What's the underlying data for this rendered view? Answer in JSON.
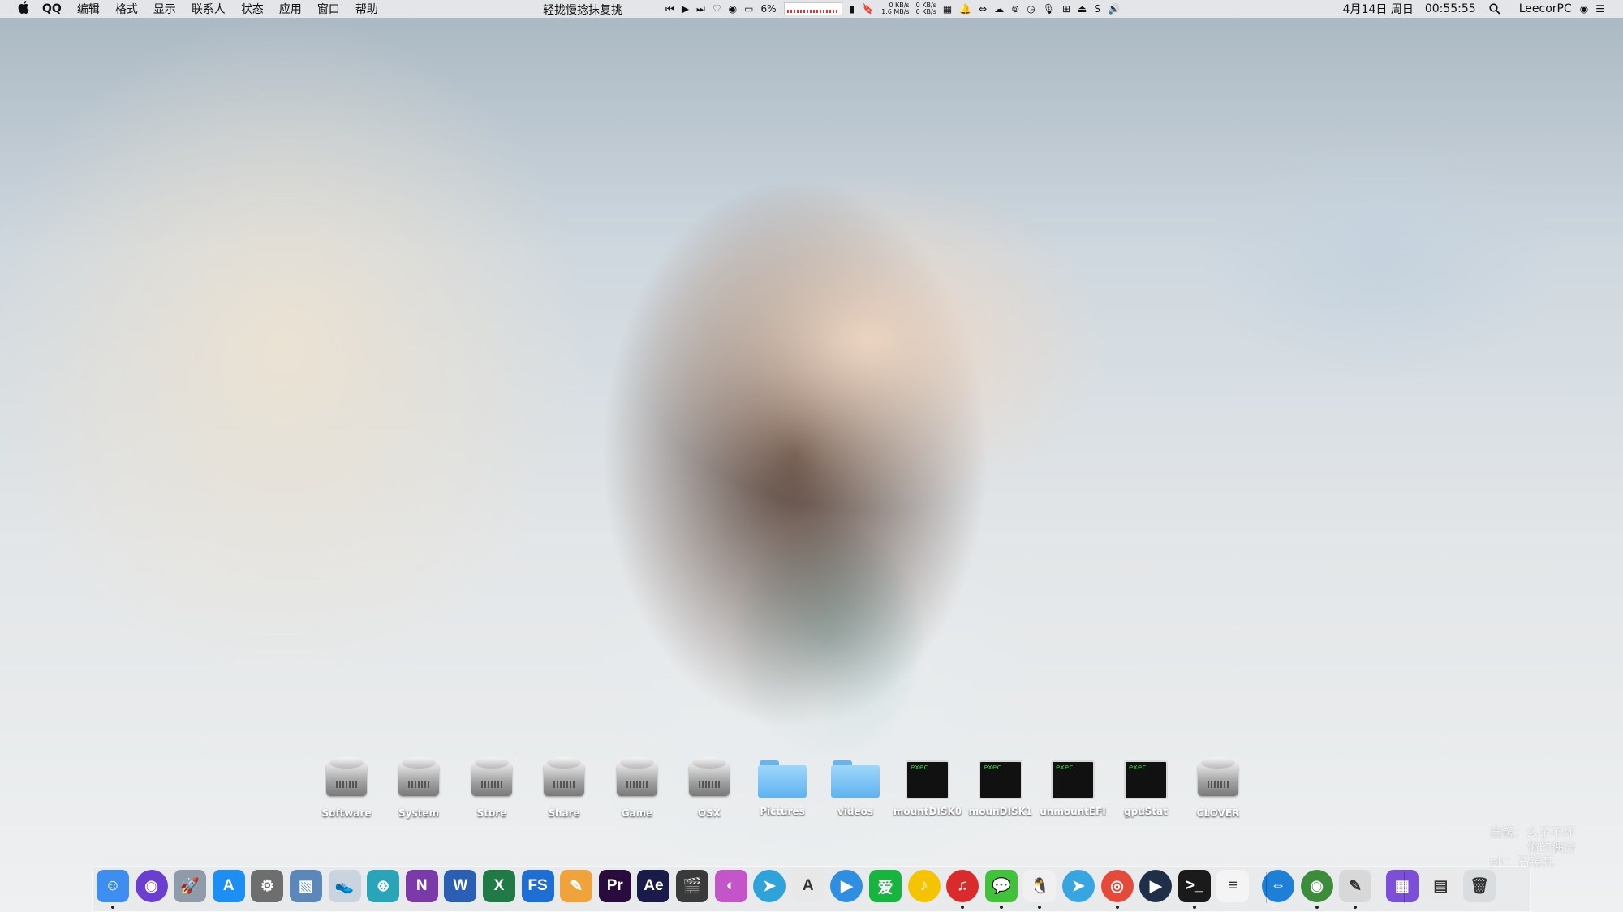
{
  "menubar": {
    "apple_icon": "apple-icon",
    "app_name": "QQ",
    "menus": [
      "编辑",
      "格式",
      "显示",
      "联系人",
      "状态",
      "应用",
      "窗口",
      "帮助"
    ],
    "now_playing": "轻拢慢捻抹复挑",
    "status": {
      "cpu_percent": "6%",
      "net_up": "0 KB/s",
      "net_down": "1.6 MB/s",
      "net2_up": "0 KB/s",
      "net2_down": "0 KB/s"
    },
    "date": "4月14日 周日",
    "time": "00:55:55",
    "user": "LeecorPC"
  },
  "desktop": {
    "icons": [
      {
        "label": "Software",
        "kind": "disk"
      },
      {
        "label": "System",
        "kind": "disk"
      },
      {
        "label": "Store",
        "kind": "disk"
      },
      {
        "label": "Share",
        "kind": "disk"
      },
      {
        "label": "Game",
        "kind": "disk"
      },
      {
        "label": "OSX",
        "kind": "disk"
      },
      {
        "label": "Pictures",
        "kind": "folder"
      },
      {
        "label": "videos",
        "kind": "folder"
      },
      {
        "label": "mountDISK0",
        "kind": "exec"
      },
      {
        "label": "mounDISK1",
        "kind": "exec"
      },
      {
        "label": "unmountEFI",
        "kind": "exec"
      },
      {
        "label": "gpuStat",
        "kind": "exec"
      },
      {
        "label": "CLOVER",
        "kind": "disk"
      }
    ],
    "exec_badge": "exec",
    "watermark_line1": "出镜：么子不坏",
    "watermark_line2": "你的偶分",
    "watermark_line3": "ph：石镜其"
  },
  "dock": {
    "apps": [
      {
        "name": "finder-icon",
        "text": "☺",
        "color": "#3e8ef0",
        "running": true
      },
      {
        "name": "siri-icon",
        "text": "◉",
        "color": "#6a3fd0",
        "running": false
      },
      {
        "name": "launchpad-icon",
        "text": "🚀",
        "color": "#8f9ba8",
        "running": false
      },
      {
        "name": "app-store-icon",
        "text": "A",
        "color": "#1c8ef4",
        "running": false
      },
      {
        "name": "system-preferences-icon",
        "text": "⚙",
        "color": "#6e6e6e",
        "running": false
      },
      {
        "name": "preview-icon",
        "text": "▧",
        "color": "#5b88b8",
        "running": false
      },
      {
        "name": "sneaker-icon",
        "text": "👟",
        "color": "#c9d4de",
        "running": false
      },
      {
        "name": "network-tool-icon",
        "text": "⊛",
        "color": "#2aa4b8",
        "running": false
      },
      {
        "name": "onenote-icon",
        "text": "N",
        "color": "#7a3aa8",
        "running": false
      },
      {
        "name": "word-icon",
        "text": "W",
        "color": "#2b5fb4",
        "running": false
      },
      {
        "name": "excel-icon",
        "text": "X",
        "color": "#1f7a45",
        "running": false
      },
      {
        "name": "fs-icon",
        "text": "FS",
        "color": "#1d6fd4",
        "running": false
      },
      {
        "name": "pages-icon",
        "text": "✎",
        "color": "#f0a33a",
        "running": false
      },
      {
        "name": "premiere-icon",
        "text": "Pr",
        "color": "#2a0b3d",
        "running": false
      },
      {
        "name": "after-effects-icon",
        "text": "Ae",
        "color": "#1b1b4a",
        "running": false
      },
      {
        "name": "final-cut-icon",
        "text": "🎬",
        "color": "#3a3a3a",
        "running": false
      },
      {
        "name": "pixelmator-icon",
        "text": "◐",
        "color": "#c455c8",
        "running": false
      },
      {
        "name": "telegram-icon",
        "text": "➤",
        "color": "#2fa3d9",
        "running": false
      },
      {
        "name": "acrobat-icon",
        "text": "A",
        "color": "#e8e8e8",
        "running": false
      },
      {
        "name": "video-player-icon",
        "text": "▶",
        "color": "#2f8ee0",
        "running": false
      },
      {
        "name": "iqiyi-icon",
        "text": "爱",
        "color": "#16b63e",
        "running": false
      },
      {
        "name": "music-icon",
        "text": "♪",
        "color": "#f5c400",
        "running": false
      },
      {
        "name": "netease-music-icon",
        "text": "♫",
        "color": "#d92b2b",
        "running": true
      },
      {
        "name": "wechat-icon",
        "text": "💬",
        "color": "#42c13a",
        "running": true
      },
      {
        "name": "qq-icon",
        "text": "🐧",
        "color": "#f0f0f0",
        "running": true
      },
      {
        "name": "telegram-desktop-icon",
        "text": "➤",
        "color": "#37a5df",
        "running": false
      },
      {
        "name": "chrome-icon",
        "text": "◎",
        "color": "#e4493a",
        "running": true
      },
      {
        "name": "quicktime-icon",
        "text": "▶",
        "color": "#1f2f48",
        "running": false
      },
      {
        "name": "terminal-icon",
        "text": ">_",
        "color": "#1a1a1a",
        "running": true
      },
      {
        "name": "textedit-icon",
        "text": "≡",
        "color": "#f4f4f4",
        "running": false
      },
      {
        "name": "teamviewer-icon",
        "text": "⇔",
        "color": "#1e7fd6",
        "running": false
      },
      {
        "name": "gpu-monitor-icon",
        "text": "◉",
        "color": "#3c8c3c",
        "running": true
      },
      {
        "name": "script-editor-icon",
        "text": "✎",
        "color": "#d8d8d8",
        "running": true
      },
      {
        "name": "app-folder-stack-icon",
        "text": "▦",
        "color": "#7b4fd6",
        "running": false
      },
      {
        "name": "documents-stack-icon",
        "text": "▤",
        "color": "#e9e9e9",
        "running": false
      },
      {
        "name": "trash-icon",
        "text": "🗑",
        "color": "#d9dde0",
        "running": false
      }
    ]
  }
}
